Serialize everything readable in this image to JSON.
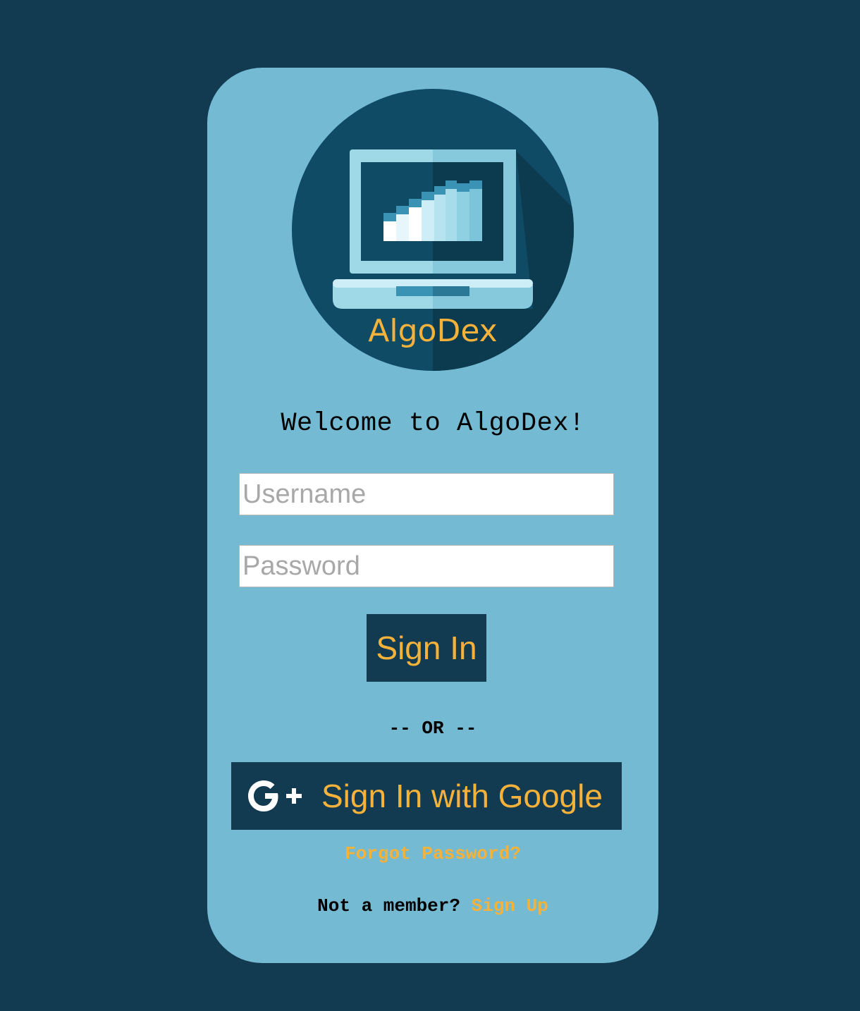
{
  "logo": {
    "text": "AlgoDex",
    "icon": "laptop-chart-icon",
    "colors": {
      "circle": "#0f4b65",
      "shadow": "#0c3a4e",
      "laptop_light": "#9fd9e8",
      "laptop_dark": "#7fc2d8",
      "screen": "#0f4b65",
      "wordmark": "#f5b23b"
    }
  },
  "welcome": "Welcome to AlgoDex!",
  "form": {
    "username_placeholder": "Username",
    "password_placeholder": "Password",
    "signin_label": "Sign In"
  },
  "divider": "-- OR --",
  "google": {
    "icon": "google-plus-icon",
    "label": "Sign In with Google"
  },
  "forgot_password": "Forgot Password?",
  "member_prompt": {
    "text": "Not a member?",
    "link": "Sign Up"
  },
  "colors": {
    "background": "#123a51",
    "card": "#74bad3",
    "accent": "#f5b23b",
    "button_bg": "#123a51"
  }
}
